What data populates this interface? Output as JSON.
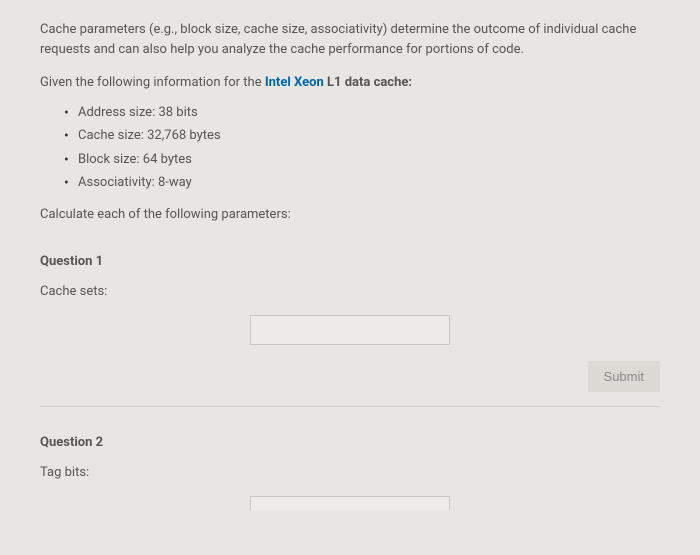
{
  "intro": "Cache parameters (e.g., block size, cache size, associativity) determine the outcome of individual cache requests and can also help you analyze the cache performance for portions of code.",
  "given_prefix": "Given the following information for the ",
  "cache_link_text": "Intel Xeon",
  "cache_bold_text": " L1 data cache:",
  "specs": {
    "item0": "Address size: 38 bits",
    "item1": "Cache size: 32,768 bytes",
    "item2": "Block size: 64 bytes",
    "item3": "Associativity: 8-way"
  },
  "calculate_text": "Calculate each of the following parameters:",
  "q1": {
    "title": "Question 1",
    "label": "Cache sets:",
    "value": ""
  },
  "submit_label": "Submit",
  "q2": {
    "title": "Question 2",
    "label": "Tag bits:",
    "value": ""
  }
}
